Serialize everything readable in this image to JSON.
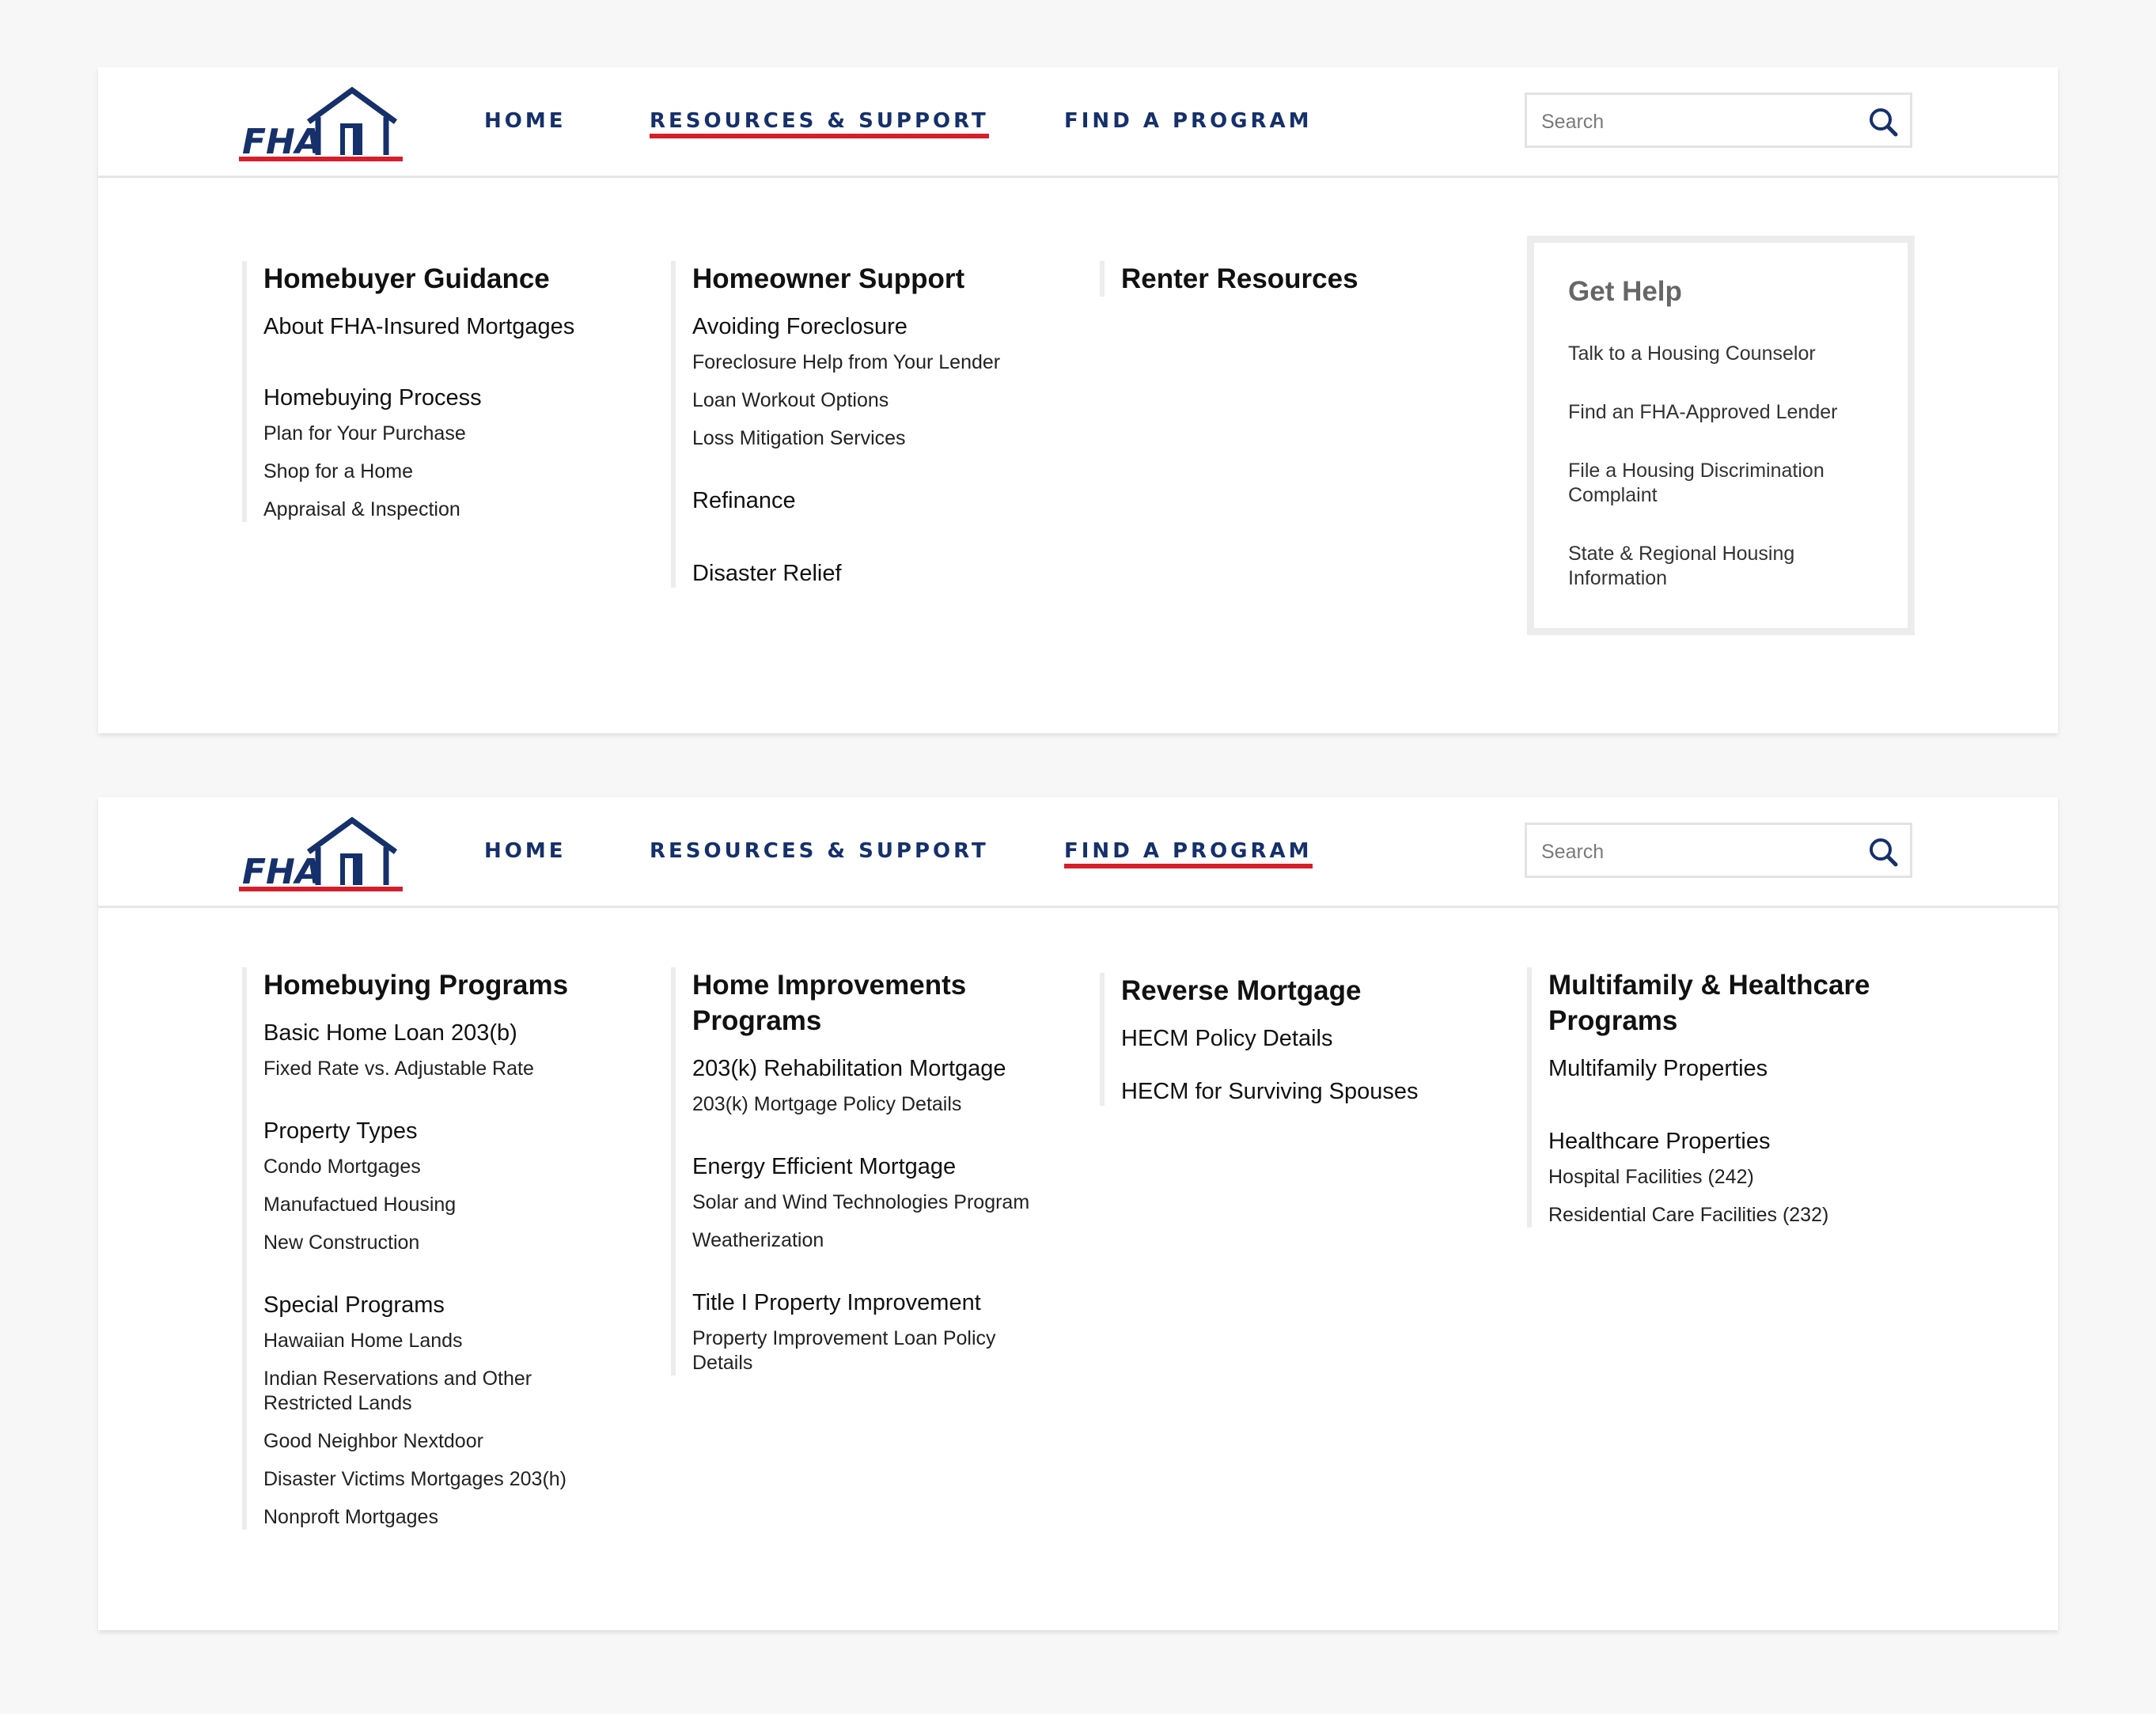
{
  "colors": {
    "navy": "#15306b",
    "accent_red": "#d81e2a",
    "page_bg": "#f7f7f7",
    "divider": "#ececec"
  },
  "logo": {
    "text": "FHA"
  },
  "panels": [
    {
      "nav": {
        "home": "HOME",
        "resources": "RESOURCES & SUPPORT",
        "program": "FIND A PROGRAM",
        "active": "resources"
      },
      "search": {
        "placeholder": "Search"
      },
      "columns": [
        {
          "title": "Homebuyer Guidance",
          "groups": [
            {
              "heading": "About FHA-Insured Mortgages",
              "links": []
            },
            {
              "heading": "Homebuying Process",
              "links": [
                "Plan for Your Purchase",
                "Shop for a Home",
                "Appraisal & Inspection"
              ]
            }
          ]
        },
        {
          "title": "Homeowner Support",
          "groups": [
            {
              "heading": "Avoiding Foreclosure",
              "links": [
                "Foreclosure Help from Your Lender",
                "Loan Workout Options",
                "Loss Mitigation Services"
              ]
            },
            {
              "heading": "Refinance",
              "links": []
            },
            {
              "heading": "Disaster Relief",
              "links": []
            }
          ]
        },
        {
          "title": "Renter Resources",
          "groups": []
        }
      ],
      "get_help": {
        "title": "Get Help",
        "links": [
          "Talk to a Housing Counselor",
          "Find an FHA-Approved Lender",
          "File a Housing Discrimination Complaint",
          "State & Regional Housing Information"
        ]
      }
    },
    {
      "nav": {
        "home": "HOME",
        "resources": "RESOURCES & SUPPORT",
        "program": "FIND A PROGRAM",
        "active": "program"
      },
      "search": {
        "placeholder": "Search"
      },
      "columns": [
        {
          "title": "Homebuying Programs",
          "groups": [
            {
              "heading": "Basic Home Loan 203(b)",
              "links": [
                "Fixed Rate vs. Adjustable Rate"
              ]
            },
            {
              "heading": "Property Types",
              "links": [
                "Condo Mortgages",
                "Manufactued Housing",
                "New Construction"
              ]
            },
            {
              "heading": "Special Programs",
              "links": [
                "Hawaiian Home Lands",
                "Indian Reservations and Other Restricted Lands",
                "Good Neighbor Nextdoor",
                "Disaster Victims Mortgages 203(h)",
                "Nonproft Mortgages"
              ]
            }
          ]
        },
        {
          "title": "Home Improvements Programs",
          "groups": [
            {
              "heading": "203(k) Rehabilitation Mortgage",
              "links": [
                "203(k) Mortgage Policy Details"
              ]
            },
            {
              "heading": "Energy Efficient Mortgage",
              "links": [
                "Solar and Wind Technologies Program",
                "Weatherization"
              ]
            },
            {
              "heading": "Title I Property Improvement",
              "links": [
                "Property Improvement Loan Policy Details"
              ]
            }
          ]
        },
        {
          "title": "Reverse Mortgage",
          "groups": [
            {
              "heading": "HECM Policy Details",
              "links": []
            },
            {
              "heading": "HECM for Surviving Spouses",
              "links": []
            }
          ]
        },
        {
          "title": "Multifamily & Healthcare Programs",
          "groups": [
            {
              "heading": "Multifamily Properties",
              "links": []
            },
            {
              "heading": "Healthcare Properties",
              "links": [
                "Hospital Facilities (242)",
                "Residential Care Facilities (232)"
              ]
            }
          ]
        }
      ]
    }
  ]
}
